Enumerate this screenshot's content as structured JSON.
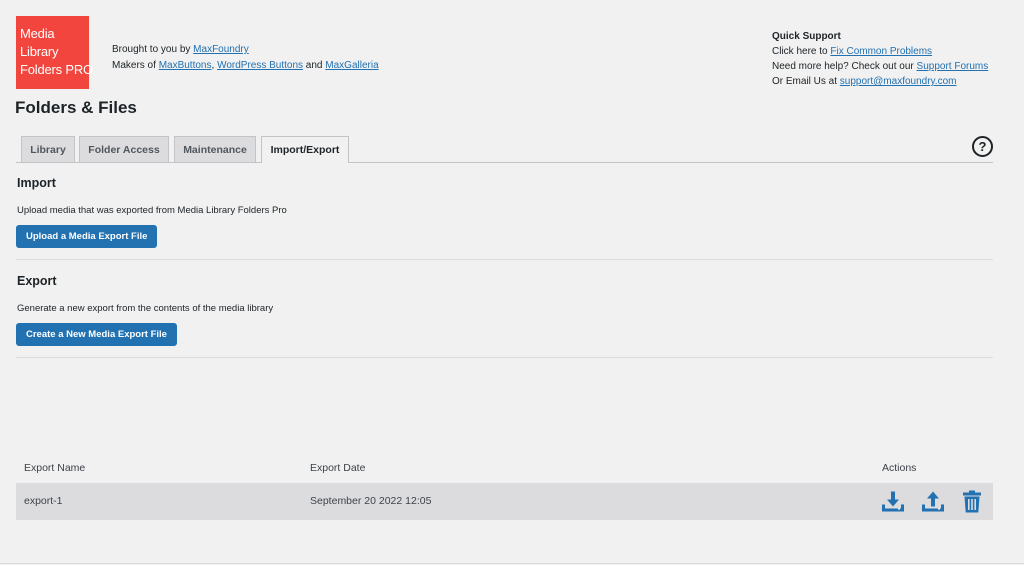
{
  "logo": {
    "line1": "Media",
    "line2": "Library",
    "line3": "Folders PRO"
  },
  "credits": {
    "brought_prefix": "Brought to you by ",
    "brought_link": "MaxFoundry",
    "makers_prefix": "Makers of ",
    "makers_link1": "MaxButtons",
    "makers_sep1": ", ",
    "makers_link2": "WordPress Buttons",
    "makers_sep2": " and ",
    "makers_link3": "MaxGalleria"
  },
  "quick_support": {
    "title": "Quick Support",
    "line1_prefix": "Click here to ",
    "line1_link": "Fix Common Problems",
    "line2_prefix": "Need more help? Check out our ",
    "line2_link": "Support Forums",
    "line3_prefix": "Or Email Us at ",
    "line3_link": "support@maxfoundry.com"
  },
  "page_title": "Folders & Files",
  "tabs": [
    {
      "label": "Library"
    },
    {
      "label": "Folder Access"
    },
    {
      "label": "Maintenance"
    },
    {
      "label": "Import/Export",
      "active": true
    }
  ],
  "help_icon": "question-circle-icon",
  "import": {
    "title": "Import",
    "description": "Upload media that was exported from Media Library Folders Pro",
    "button": "Upload a Media Export File"
  },
  "export": {
    "title": "Export",
    "description": "Generate a new export from the contents of the media library",
    "button": "Create a New Media Export File"
  },
  "table": {
    "headers": {
      "name": "Export Name",
      "date": "Export Date",
      "actions": "Actions"
    },
    "rows": [
      {
        "name": "export-1",
        "date": "September 20 2022 12:05",
        "actions": [
          "download-icon",
          "upload-icon",
          "trash-icon"
        ]
      }
    ]
  },
  "colors": {
    "accent": "#2271b1",
    "logo_bg": "#f1453d",
    "row_bg": "#dcdcde"
  }
}
